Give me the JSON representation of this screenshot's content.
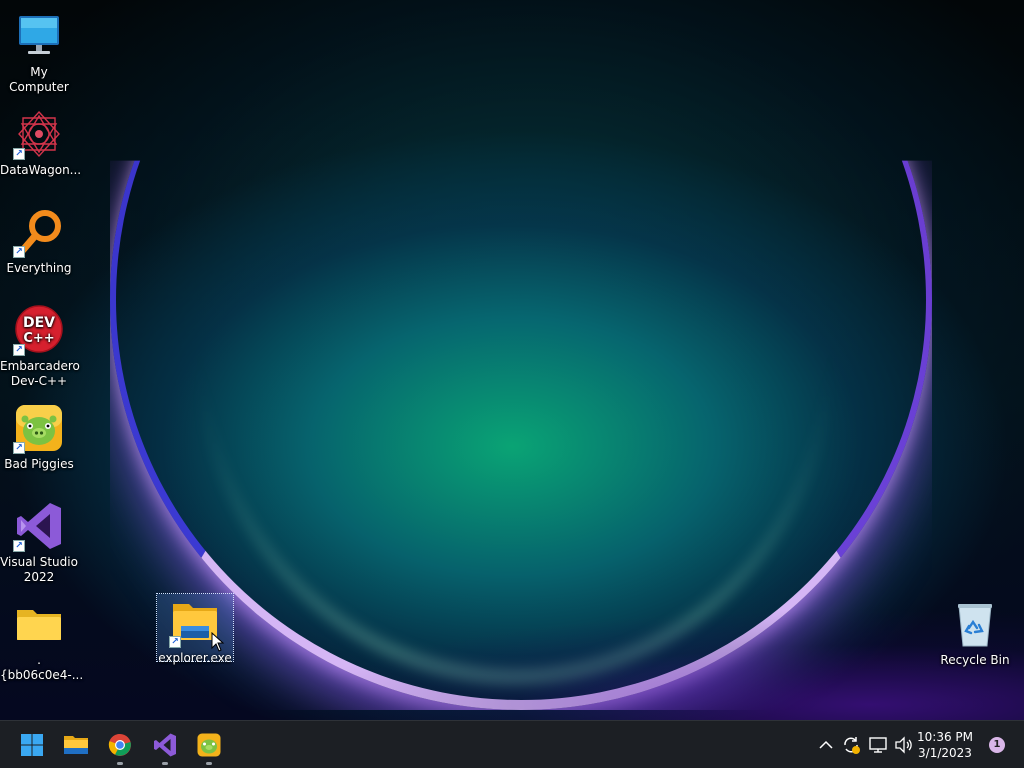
{
  "desktop": {
    "icons": [
      {
        "label": "My Computer",
        "icon": "monitor-icon"
      },
      {
        "label": "DataWagon...",
        "icon": "datawagon-icon"
      },
      {
        "label": "Everything",
        "icon": "magnifier-icon"
      },
      {
        "label": "Embarcadero Dev-C++",
        "icon": "devcpp-icon",
        "badge": "DEV C++"
      },
      {
        "label": "Bad Piggies",
        "icon": "bad-piggies-icon"
      },
      {
        "label": "Visual Studio 2022",
        "icon": "visual-studio-icon"
      },
      {
        "label": ".{bb06c0e4-...",
        "icon": "folder-icon"
      },
      {
        "label": "explorer.exe",
        "icon": "file-explorer-icon",
        "selected": true
      },
      {
        "label": "Recycle Bin",
        "icon": "recycle-bin-icon"
      }
    ],
    "accent": "#0b9e78"
  },
  "taskbar": {
    "pinned": [
      "windows-start-icon",
      "file-explorer-icon",
      "chrome-icon",
      "visual-studio-icon",
      "bad-piggies-icon"
    ],
    "clock": {
      "time": "10:36 PM",
      "date": "3/1/2023"
    },
    "notification_count": "1"
  }
}
